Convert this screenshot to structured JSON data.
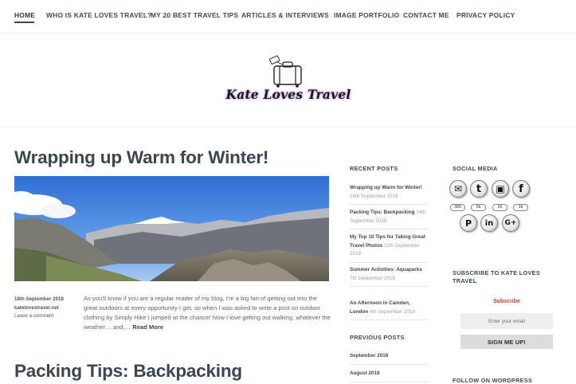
{
  "nav": {
    "items": [
      {
        "label": "HOME"
      },
      {
        "label": "WHO IS KATE LOVES TRAVEL?"
      },
      {
        "label": "MY 20 BEST TRAVEL TIPS"
      },
      {
        "label": "ARTICLES & INTERVIEWS"
      },
      {
        "label": "IMAGE PORTFOLIO"
      },
      {
        "label": "CONTACT ME"
      },
      {
        "label": "PRIVACY POLICY"
      }
    ],
    "active": "HOME"
  },
  "header": {
    "logo_text": "Kate Loves Travel",
    "logo_icon": "suitcase-icon"
  },
  "posts": [
    {
      "title": "Wrapping up Warm for Winter!",
      "date": "18th September 2018",
      "site": "katelovestravel.net",
      "comment": "Leave a comment",
      "excerpt": "As you'll know if you are a regular reader of my blog, I'm a big fan of getting out into the great outdoors at every opportunity I get, so when I was asked to write a post on outdoor clothing by Simply Hike I jumped at the chance! Now I love getting out walking, whatever the weather… and,…",
      "read_more": "Read More"
    },
    {
      "title": "Packing Tips: Backpacking"
    }
  ],
  "recent_posts": {
    "title": "RECENT POSTS",
    "items": [
      {
        "title": "Wrapping up Warm for Winter!",
        "date": "18th September 2018"
      },
      {
        "title": "Packing Tips: Backpacking",
        "date": "14th September 2018"
      },
      {
        "title": "My Top 10 Tips for Taking Great Travel Photos",
        "date": "11th September 2018"
      },
      {
        "title": "Summer Activities: Aquaparks",
        "date": "7th September 2018"
      },
      {
        "title": "An Afternoon in Camden, London",
        "date": "4th September 2018"
      }
    ]
  },
  "previous_posts": {
    "title": "PREVIOUS POSTS",
    "items": [
      "September 2018",
      "August 2018"
    ]
  },
  "social": {
    "title": "SOCIAL MEDIA",
    "icons": [
      {
        "name": "email-icon",
        "glyph": "✉",
        "count": "380"
      },
      {
        "name": "twitter-icon",
        "glyph": "t",
        "count": "5k"
      },
      {
        "name": "instagram-icon",
        "glyph": "▣",
        "count": "2k"
      },
      {
        "name": "facebook-icon",
        "glyph": "f",
        "count": "1k"
      },
      {
        "name": "pinterest-icon",
        "glyph": "P",
        "count": ""
      },
      {
        "name": "linkedin-icon",
        "glyph": "in",
        "count": ""
      },
      {
        "name": "google-plus-icon",
        "glyph": "G+",
        "count": ""
      }
    ]
  },
  "subscribe": {
    "title": "SUBSCRIBE TO KATE LOVES TRAVEL",
    "label": "Subscribe",
    "placeholder": "Enter your email",
    "button": "SIGN ME UP!"
  },
  "follow": {
    "title": "FOLLOW ON WORDPRESS"
  },
  "colors": {
    "text": "#3b4652",
    "accent_red": "#c0392b",
    "logo_glow": "#b38ad6"
  }
}
